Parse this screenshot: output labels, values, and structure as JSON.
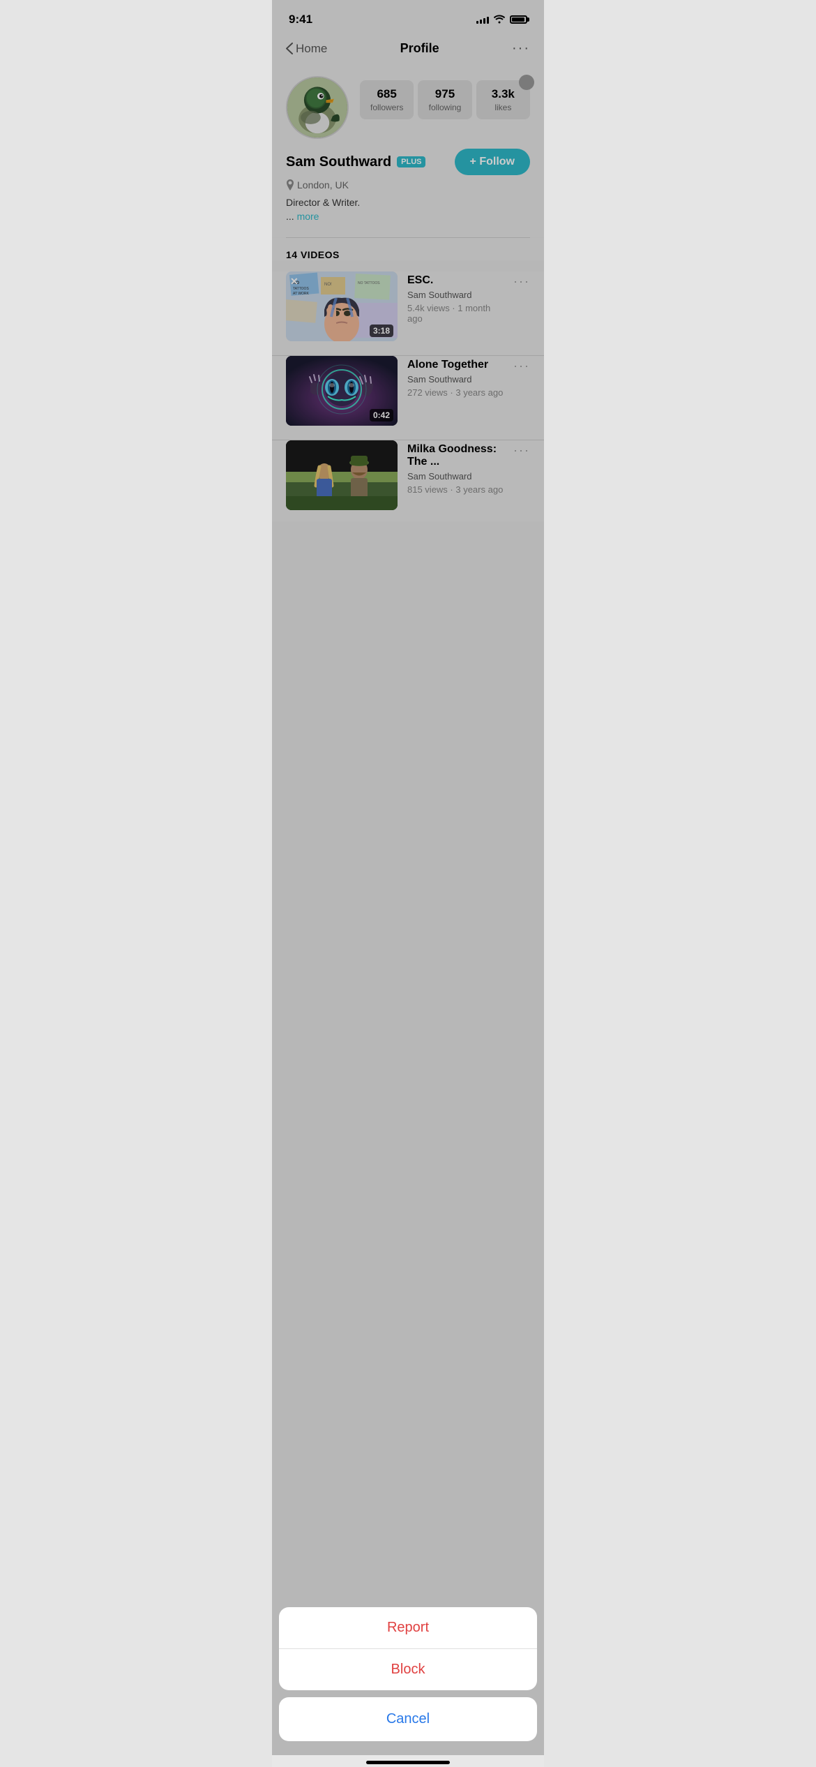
{
  "statusBar": {
    "time": "9:41",
    "signalBars": [
      3,
      5,
      7,
      9,
      11
    ],
    "wifiLabel": "wifi",
    "batteryLabel": "battery"
  },
  "nav": {
    "backLabel": "Home",
    "title": "Profile",
    "moreLabel": "···"
  },
  "profile": {
    "name": "Sam Southward",
    "plusBadge": "PLUS",
    "location": "London, UK",
    "bio": "Director & Writer.",
    "bioMore": "more",
    "followButton": "+ Follow",
    "stats": [
      {
        "number": "685",
        "label": "followers"
      },
      {
        "number": "975",
        "label": "following"
      },
      {
        "number": "3.3k",
        "label": "likes"
      }
    ]
  },
  "videos": {
    "header": "14 VIDEOS",
    "items": [
      {
        "title": "ESC.",
        "creator": "Sam Southward",
        "meta": "5.4k views · 1 month ago",
        "duration": "3:18",
        "thumbType": "esc"
      },
      {
        "title": "Alone Together",
        "creator": "Sam Southward",
        "meta": "272 views · 3 years ago",
        "duration": "0:42",
        "thumbType": "alone"
      },
      {
        "title": "Milka Goodness: The ...",
        "creator": "Sam Southward",
        "meta": "815 views · 3 years ago",
        "duration": "",
        "thumbType": "milka"
      }
    ]
  },
  "actionSheet": {
    "items": [
      {
        "label": "Report",
        "type": "destructive"
      },
      {
        "label": "Block",
        "type": "destructive"
      }
    ],
    "cancelLabel": "Cancel"
  }
}
